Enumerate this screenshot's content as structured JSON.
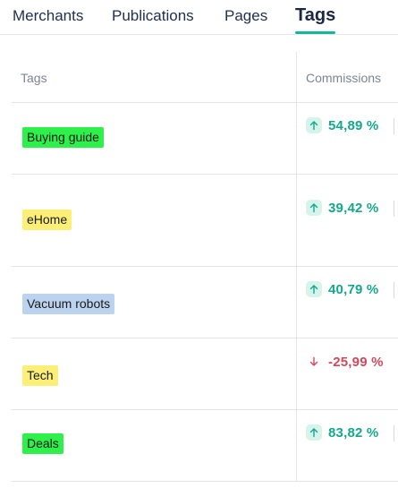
{
  "tabs": [
    {
      "label": "Merchants",
      "active": false
    },
    {
      "label": "Publications",
      "active": false
    },
    {
      "label": "Pages",
      "active": false
    },
    {
      "label": "Tags",
      "active": true
    }
  ],
  "accent_color": "#15b79a",
  "table": {
    "headers": {
      "tags": "Tags",
      "commissions": "Commissions"
    },
    "rows": [
      {
        "tag": "Buying guide",
        "tag_color": "#2ef04a",
        "commission": "54,89 %",
        "trend": "up",
        "icon": "arrow-up-icon"
      },
      {
        "tag": "eHome",
        "tag_color": "#fbef77",
        "commission": "39,42 %",
        "trend": "up",
        "icon": "arrow-up-icon"
      },
      {
        "tag": "Vacuum robots",
        "tag_color": "#bcd3f0",
        "commission": "40,79 %",
        "trend": "up",
        "icon": "arrow-up-icon"
      },
      {
        "tag": "Tech",
        "tag_color": "#fbef77",
        "commission": "-25,99 %",
        "trend": "down",
        "icon": "arrow-down-icon"
      },
      {
        "tag": "Deals",
        "tag_color": "#2ef04a",
        "commission": "83,82 %",
        "trend": "up",
        "icon": "arrow-up-icon"
      }
    ]
  }
}
